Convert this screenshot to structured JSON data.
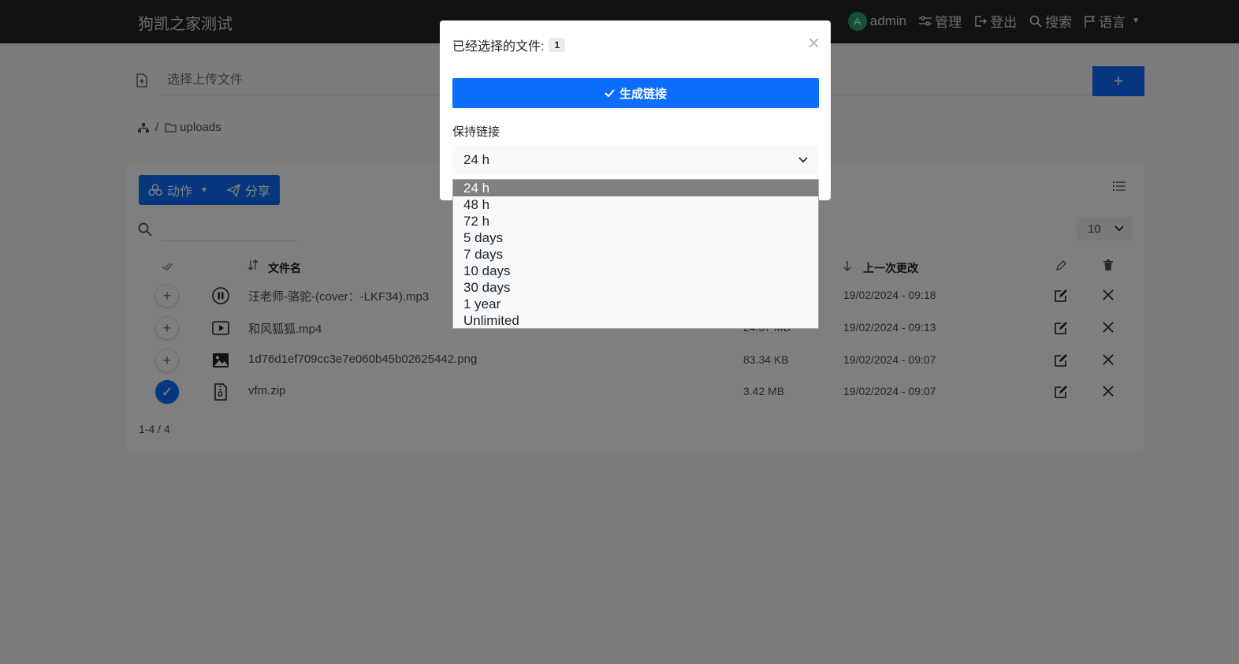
{
  "app": {
    "title": "狗凯之家测试"
  },
  "nav": {
    "avatar_letter": "A",
    "user": "admin",
    "manage": "管理",
    "logout": "登出",
    "search": "搜索",
    "language": "语言"
  },
  "upload": {
    "placeholder": "选择上传文件",
    "button": "+"
  },
  "breadcrumb": {
    "separator": "/",
    "folder": "uploads"
  },
  "toolbar": {
    "actions": "动作",
    "share": "分享"
  },
  "perpage": {
    "value": "10"
  },
  "table": {
    "col_name": "文件名",
    "col_modified": "上一次更改",
    "rows": [
      {
        "name": "汪老师-骆驼-(cover：-LKF34).mp3",
        "size": "",
        "date": "19/02/2024 - 09:18",
        "selected": false,
        "type": "audio"
      },
      {
        "name": "和风狐狐.mp4",
        "size": "24.37 MB",
        "date": "19/02/2024 - 09:13",
        "selected": false,
        "type": "video"
      },
      {
        "name": "1d76d1ef709cc3e7e060b45b02625442.png",
        "size": "83.34 KB",
        "date": "19/02/2024 - 09:07",
        "selected": false,
        "type": "image"
      },
      {
        "name": "vfm.zip",
        "size": "3.42 MB",
        "date": "19/02/2024 - 09:07",
        "selected": true,
        "type": "archive"
      }
    ],
    "footer": "1-4 / 4"
  },
  "modal": {
    "title": "已经选择的文件:",
    "count": "1",
    "close": "×",
    "generate": "生成链接",
    "keep_label": "保持链接",
    "selected": "24 h",
    "options": [
      "24 h",
      "48 h",
      "72 h",
      "5 days",
      "7 days",
      "10 days",
      "30 days",
      "1 year",
      "Unlimited"
    ]
  },
  "colors": {
    "primary": "#0d6efd",
    "navbar": "#212529",
    "avatar": "#26a269"
  }
}
